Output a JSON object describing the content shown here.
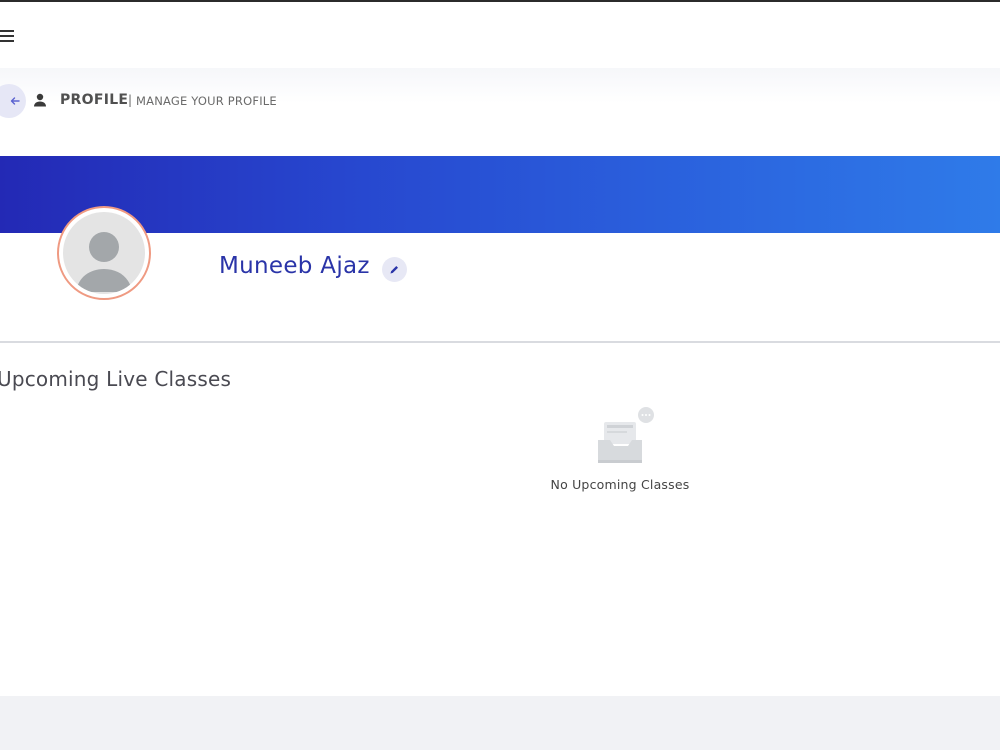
{
  "header": {
    "menu_icon": "hamburger-menu-icon"
  },
  "breadcrumb": {
    "back_icon": "arrow-left-icon",
    "section_icon": "person-icon",
    "title": "PROFILE",
    "separator": "|",
    "subtitle": "MANAGE YOUR PROFILE"
  },
  "profile": {
    "name": "Muneeb Ajaz",
    "edit_icon": "pencil-icon",
    "avatar_icon": "default-avatar-icon"
  },
  "upcoming": {
    "title": "Upcoming Live Classes",
    "empty_icon": "empty-inbox-icon",
    "empty_message": "No Upcoming Classes"
  },
  "colors": {
    "banner_start": "#2329b5",
    "banner_end": "#2f7be9",
    "name_color": "#2a34a8",
    "avatar_ring": "#ef9a82"
  }
}
